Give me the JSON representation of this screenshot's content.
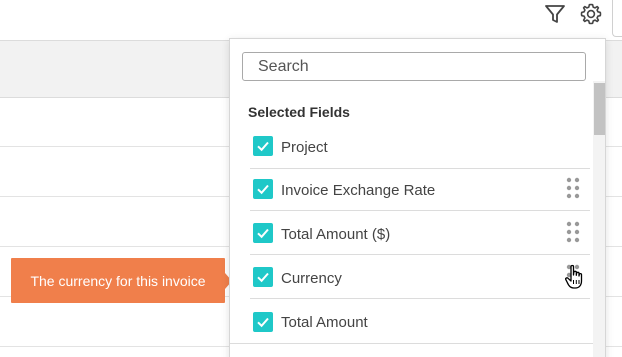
{
  "toolbar": {
    "filter_icon": "filter-icon",
    "settings_icon": "gear-icon"
  },
  "tooltip": {
    "text": "The currency for this invoice",
    "color": "#f07f4b"
  },
  "panel": {
    "search": {
      "placeholder": "Search",
      "value": ""
    },
    "section_title": "Selected Fields",
    "fields": [
      {
        "label": "Project",
        "checked": true,
        "draggable": false
      },
      {
        "label": "Invoice Exchange Rate",
        "checked": true,
        "draggable": true
      },
      {
        "label": "Total Amount ($)",
        "checked": true,
        "draggable": true
      },
      {
        "label": "Currency",
        "checked": true,
        "draggable": true
      },
      {
        "label": "Total Amount",
        "checked": true,
        "draggable": false
      }
    ]
  },
  "colors": {
    "accent": "#1fc8c8",
    "tooltip": "#f07f4b"
  }
}
